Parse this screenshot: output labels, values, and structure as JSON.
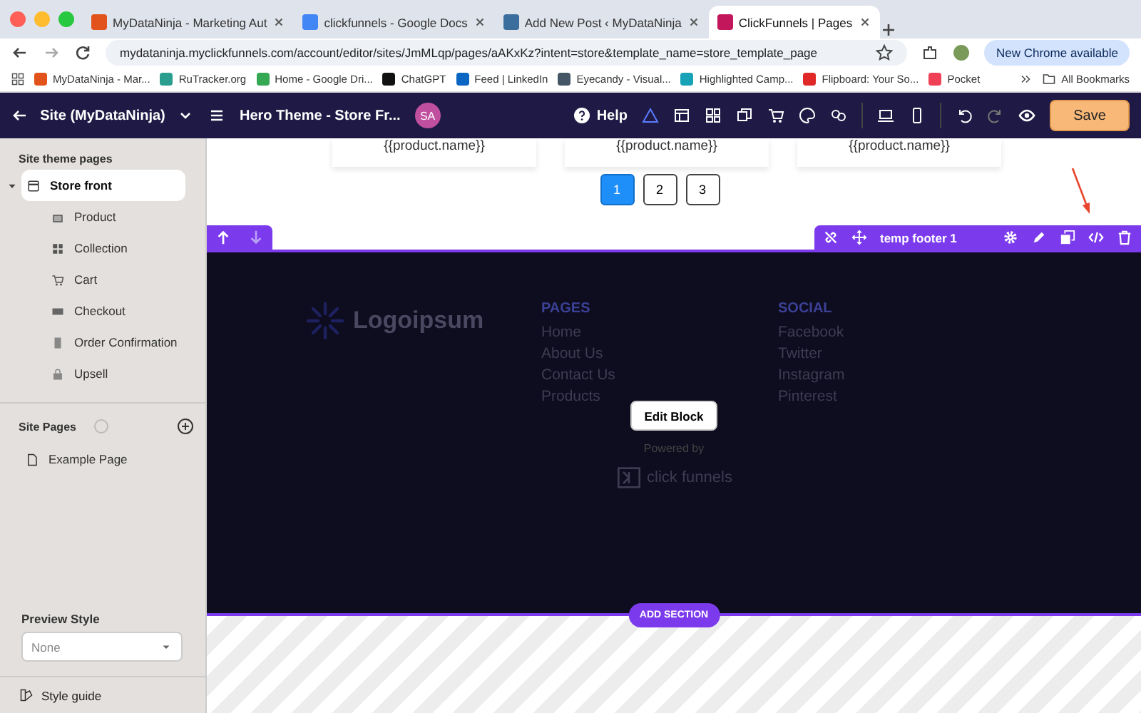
{
  "browser": {
    "tabs": [
      {
        "title": "MyDataNinja - Marketing Aut",
        "selected": false
      },
      {
        "title": "clickfunnels - Google Docs",
        "selected": false
      },
      {
        "title": "Add New Post ‹ MyDataNinja",
        "selected": false
      },
      {
        "title": "ClickFunnels | Pages",
        "selected": true
      }
    ],
    "url": "mydataninja.myclickfunnels.com/account/editor/sites/JmMLqp/pages/aAKxKz?intent=store&template_name=store_template_page",
    "update_button": "New Chrome available",
    "bookmarks": [
      "MyDataNinja - Mar...",
      "RuTracker.org",
      "Home - Google Dri...",
      "ChatGPT",
      "Feed | LinkedIn",
      "Eyecandy - Visual...",
      "Highlighted Camp...",
      "Flipboard: Your So...",
      "Pocket"
    ],
    "all_bookmarks": "All Bookmarks"
  },
  "editor_header": {
    "site": "Site (MyDataNinja)",
    "page_title": "Hero Theme - Store Fr...",
    "avatar": "SA",
    "help": "Help",
    "save": "Save"
  },
  "sidebar": {
    "theme_heading": "Site theme pages",
    "theme_pages": [
      {
        "label": "Store front",
        "selected": true,
        "expanded": true,
        "children": [
          {
            "label": "Product",
            "selected": false
          },
          {
            "label": "Collection",
            "selected": false
          },
          {
            "label": "Cart",
            "selected": false
          },
          {
            "label": "Checkout",
            "selected": false
          },
          {
            "label": "Order Confirmation",
            "selected": false
          },
          {
            "label": "Upsell",
            "selected": false
          }
        ]
      }
    ],
    "site_pages_heading": "Site Pages",
    "site_pages": [
      {
        "label": "Example Page",
        "selected": false
      }
    ],
    "preview_style": {
      "label": "Preview Style",
      "value": "None"
    },
    "style_guide": "Style guide"
  },
  "canvas": {
    "product_cards": [
      "{{product.name}}",
      "{{product.name}}",
      "{{product.name}}"
    ],
    "pagination": [
      {
        "label": "1",
        "selected": true
      },
      {
        "label": "2",
        "selected": false
      },
      {
        "label": "3",
        "selected": false
      }
    ],
    "section_toolbar": {
      "name": "temp footer 1"
    },
    "footer": {
      "logo": "Logoipsum",
      "columns": [
        {
          "heading": "PAGES",
          "links": [
            "Home",
            "About Us",
            "Contact Us",
            "Products"
          ]
        },
        {
          "heading": "SOCIAL",
          "links": [
            "Facebook",
            "Twitter",
            "Instagram",
            "Pinterest"
          ]
        }
      ],
      "edit_block": "Edit Block",
      "powered_by": "Powered by",
      "brand": "click funnels"
    },
    "add_section": "ADD SECTION"
  }
}
